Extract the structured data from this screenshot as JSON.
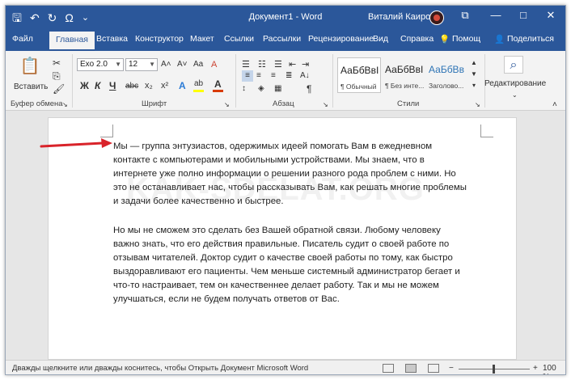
{
  "title_bar": {
    "title": "Документ1 - Word",
    "user": "Виталий Каиров",
    "qat_icons": [
      "save-icon",
      "undo-icon",
      "redo-icon",
      "symbol-icon",
      "customize-icon"
    ]
  },
  "qat": {
    "save": "🖫",
    "undo": "↶",
    "redo": "↻",
    "omega": "Ω",
    "more": "⌄"
  },
  "window_controls": {
    "ribbon_options": "⧉",
    "minimize": "—",
    "maximize": "□",
    "close": "✕"
  },
  "tabs": [
    "Файл",
    "Главная",
    "Вставка",
    "Конструктор",
    "Макет",
    "Ссылки",
    "Рассылки",
    "Рецензирование",
    "Вид",
    "Справка",
    "Помощ",
    "Поделиться"
  ],
  "help_icons": {
    "bulb": "💡",
    "person": "👤"
  },
  "ribbon": {
    "clipboard": {
      "label": "Буфер обмена",
      "paste": "Вставить",
      "cut": "✂",
      "copy": "⎘",
      "format": "🖌"
    },
    "font": {
      "label": "Шрифт",
      "font_name": "Exo 2.0",
      "font_size": "12",
      "grow": "A˄",
      "shrink": "A˅",
      "case": "Aa",
      "clear": "A",
      "bold": "Ж",
      "italic": "К",
      "underline": "Ч",
      "strike": "abc",
      "subscript": "x₂",
      "superscript": "x²",
      "effects": "A",
      "highlight": "ab",
      "color": "A"
    },
    "paragraph": {
      "label": "Абзац",
      "pilcrow": "¶",
      "sort": "A↓"
    },
    "styles": {
      "label": "Стили",
      "items": [
        {
          "sample": "АаБбВвI",
          "name": "¶ Обычный"
        },
        {
          "sample": "АаБбВвI",
          "name": "¶ Без инте..."
        },
        {
          "sample": "АаБбВв",
          "name": "Заголово..."
        }
      ]
    },
    "editing": {
      "label": "Редактирование",
      "search": "⌕"
    },
    "launcher": "↘",
    "collapse": "˄"
  },
  "document": {
    "watermark": "KAK-SDELAT.ORG",
    "paragraph1": [
      "Мы — группа энтузиастов, одержимых идеей помогать Вам в ежедневном",
      "контакте с компьютерами и мобильными устройствами. Мы знаем, что в",
      "интернете уже полно информации о решении разного рода проблем с ними. Но",
      "это не останавливает нас, чтобы рассказывать Вам, как решать многие проблемы",
      "и задачи более качественно и быстрее."
    ],
    "paragraph2": [
      "Но мы не сможем это сделать без Вашей обратной связи. Любому человеку",
      "важно знать, что его действия правильные. Писатель судит о своей работе по",
      "отзывам читателей. Доктор судит о качестве своей работы по тому, как быстро",
      "выздоравливают его пациенты. Чем меньше системный администратор бегает и",
      "что-то настраивает, тем он качественнее делает работу. Так и мы не можем",
      "улучшаться, если не будем получать ответов от Вас."
    ]
  },
  "status_bar": {
    "message": "Дважды щелкните или дважды коснитесь, чтобы Открыть Документ Microsoft Word",
    "zoom_minus": "−",
    "zoom_plus": "+",
    "zoom": "100 %",
    "zoom_level": 1.0
  },
  "colors": {
    "accent": "#2b579a",
    "arrow": "#d9232a",
    "highlight": "#ffff00",
    "font_color": "#d83b01"
  }
}
